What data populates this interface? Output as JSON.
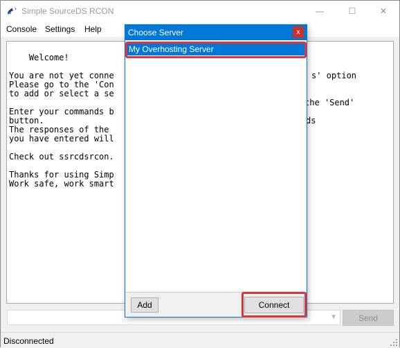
{
  "window": {
    "title": "Simple SourceDS RCON"
  },
  "caption": {
    "minimize": "—",
    "maximize": "☐",
    "close": "✕"
  },
  "menu": [
    "Console",
    "Settings",
    "Help"
  ],
  "console": {
    "text": "Welcome!\n\nYou are not yet conne\nPlease go to the 'Con\nto add or select a se\n\nEnter your commands b\nbutton.\nThe responses of the \nyou have entered will\n\nCheck out ssrcdsrcon.\n\nThanks for using Simp\nWork safe, work smart",
    "right_fragments": [
      {
        "line": 3,
        "text": "s' option"
      },
      {
        "line": 6,
        "text": "the 'Send'"
      },
      {
        "line": 8,
        "text": "ds"
      }
    ]
  },
  "command": {
    "value": "",
    "send_label": "Send"
  },
  "status": {
    "text": "Disconnected"
  },
  "dialog": {
    "title": "Choose Server",
    "close_label": "x",
    "servers": [
      "My Overhosting Server"
    ],
    "add_label": "Add",
    "connect_label": "Connect"
  },
  "colors": {
    "accent": "#0078d7",
    "highlight": "#e0333a",
    "close_red": "#c9312a"
  }
}
